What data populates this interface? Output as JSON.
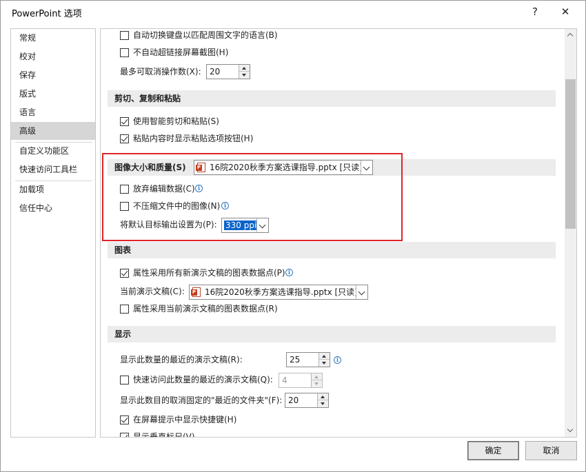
{
  "window": {
    "title": "PowerPoint 选项",
    "help": "?",
    "close": "✕"
  },
  "nav": {
    "items": [
      "常规",
      "校对",
      "保存",
      "版式",
      "语言",
      "高级",
      "自定义功能区",
      "快速访问工具栏",
      "加载项",
      "信任中心"
    ],
    "active": "高级"
  },
  "editing": {
    "auto_keyboard": "自动切换键盘以匹配周围文字的语言(B)",
    "no_hyperlink_screenshot": "不自动超链接屏幕截图(H)",
    "max_undo_label": "最多可取消操作数(X):",
    "max_undo_value": "20"
  },
  "cut_copy_paste": {
    "header": "剪切、复制和粘贴",
    "smart_cut_paste": "使用智能剪切和粘贴(S)",
    "show_paste_options": "粘贴内容时显示粘贴选项按钮(H)",
    "smart_cut_paste_checked": true,
    "show_paste_options_checked": true
  },
  "image_size_quality": {
    "header": "图像大小和质量(S)",
    "file": "16院2020秋季方案选课指导.pptx [只读]",
    "discard_edit_data": "放弃编辑数据(C)",
    "no_compress": "不压缩文件中的图像(N)",
    "default_output_label": "将默认目标输出设置为(P):",
    "default_output_value": "330 ppi"
  },
  "chart": {
    "header": "图表",
    "all_new_docs_props": "属性采用所有新演示文稿的图表数据点(P)",
    "all_new_docs_props_checked": true,
    "current_doc_label": "当前演示文稿(C):",
    "current_doc_value": "16院2020秋季方案选课指导.pptx [只读]",
    "current_doc_props": "属性采用当前演示文稿的图表数据点(R)"
  },
  "display": {
    "header": "显示",
    "recent_docs_label": "显示此数量的最近的演示文稿(R):",
    "recent_docs_value": "25",
    "quick_access_label": "快速访问此数量的最近的演示文稿(Q):",
    "quick_access_value": "4",
    "unpinned_folders_label": "显示此数目的取消固定的\"最近的文件夹\"(F):",
    "unpinned_folders_value": "20",
    "show_shortcuts": "在屏幕提示中显示快捷键(H)",
    "show_shortcuts_checked": true,
    "show_vertical_ruler": "显示垂直标尺(V)",
    "show_vertical_ruler_checked": true
  },
  "buttons": {
    "ok": "确定",
    "cancel": "取消"
  },
  "colors": {
    "highlight_border": "#e0232a",
    "selection": "#0a64c9",
    "nav_active": "#d6d6d6",
    "section_bg": "#ececec"
  },
  "icons": [
    "info-icon",
    "pptx-file-icon",
    "dropdown-arrow-icon",
    "spin-up-icon",
    "spin-down-icon",
    "scroll-up-icon",
    "scroll-down-icon",
    "close-icon",
    "help-icon"
  ]
}
